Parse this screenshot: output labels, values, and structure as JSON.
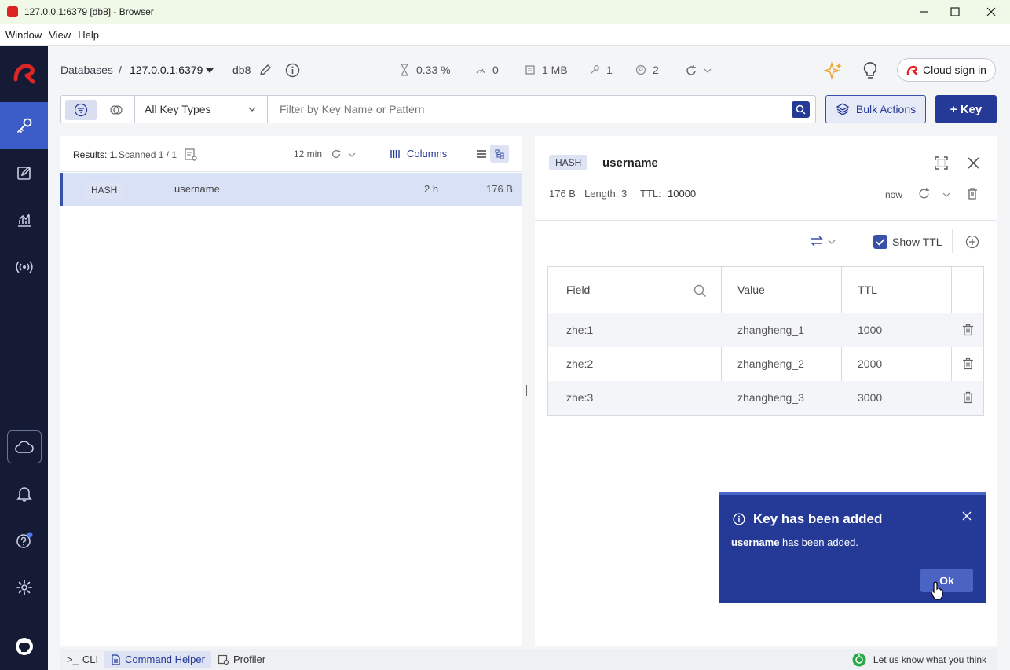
{
  "window": {
    "title": "127.0.0.1:6379 [db8] - Browser"
  },
  "menu": [
    "Window",
    "View",
    "Help"
  ],
  "breadcrumb": {
    "databases": "Databases",
    "separator": "/",
    "host": "127.0.0.1:6379",
    "db": "db8"
  },
  "stats": {
    "cpu": "0.33 %",
    "ops": "0",
    "memory": "1 MB",
    "keys": "1",
    "clients": "2"
  },
  "cloud": {
    "label": "Cloud sign in"
  },
  "filter": {
    "type_select": "All Key Types",
    "placeholder": "Filter by Key Name or Pattern"
  },
  "actions": {
    "bulk": "Bulk Actions",
    "add_key": "+ Key"
  },
  "list": {
    "results_label": "Results: 1.",
    "scanned_label": "Scanned 1 / 1",
    "last_refresh": "12 min",
    "columns_label": "Columns",
    "rows": [
      {
        "type": "HASH",
        "name": "username",
        "ttl": "2 h",
        "size": "176 B"
      }
    ]
  },
  "details": {
    "type": "HASH",
    "key": "username",
    "size": "176 B",
    "length_label": "Length: 3",
    "ttl_label": "TTL:",
    "ttl_value": "10000",
    "refreshed": "now",
    "show_ttl_label": "Show TTL",
    "table": {
      "headers": [
        "Field",
        "Value",
        "TTL"
      ],
      "rows": [
        {
          "field": "zhe:1",
          "value": "zhangheng_1",
          "ttl": "1000"
        },
        {
          "field": "zhe:2",
          "value": "zhangheng_2",
          "ttl": "2000"
        },
        {
          "field": "zhe:3",
          "value": "zhangheng_3",
          "ttl": "3000"
        }
      ]
    }
  },
  "toast": {
    "title": "Key has been added",
    "key": "username",
    "message": "has been added.",
    "ok": "Ok"
  },
  "bottom": {
    "cli": "CLI",
    "cli_prompt": ">_",
    "helper": "Command Helper",
    "profiler": "Profiler",
    "feedback": "Let us know what you think"
  },
  "colors": {
    "brand": "#253a97",
    "sidebar": "#151a35",
    "logo": "#dc2626",
    "active_row": "#d8e1f6"
  }
}
